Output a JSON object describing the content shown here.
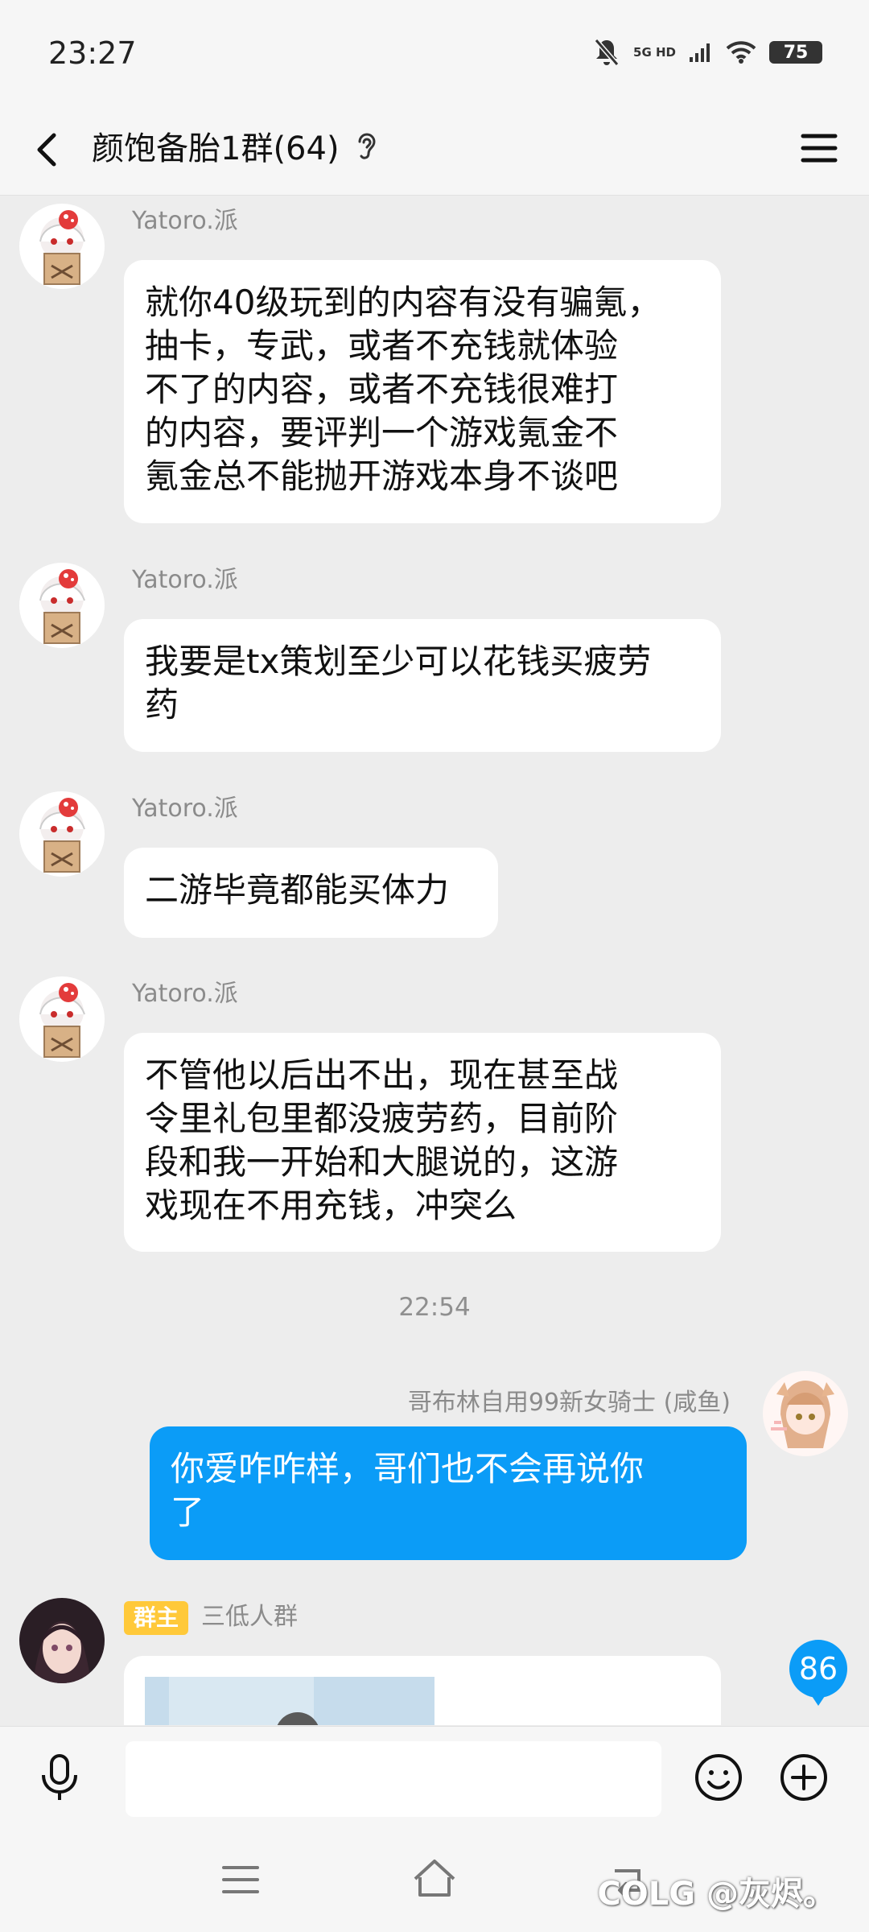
{
  "status": {
    "time": "23:27",
    "network": "5G HD",
    "battery": "75"
  },
  "header": {
    "title": "颜饱备胎1群(64)"
  },
  "messages": [
    {
      "sender": "Yatoro.派",
      "text": "就你40级玩到的内容有没有骗氪，\n抽卡，专武，或者不充钱就体验\n不了的内容，或者不充钱很难打\n的内容，要评判一个游戏氪金不\n氪金总不能抛开游戏本身不谈吧"
    },
    {
      "sender": "Yatoro.派",
      "text": "我要是tx策划至少可以花钱买疲劳\n药"
    },
    {
      "sender": "Yatoro.派",
      "text": "二游毕竟都能买体力"
    },
    {
      "sender": "Yatoro.派",
      "text": "不管他以后出不出，现在甚至战\n令里礼包里都没疲劳药，目前阶\n段和我一开始和大腿说的，这游\n戏现在不用充钱，冲突么"
    },
    {
      "timestamp": "22:54"
    },
    {
      "sender": "哥布林自用99新女骑士 (咸鱼)",
      "text": "你爱咋咋样，哥们也不会再说你\n了"
    },
    {
      "badge": "群主",
      "sender": "三低人群"
    }
  ],
  "unread_count": "86",
  "input": {
    "placeholder": ""
  },
  "watermark": "COLG @灰烬。",
  "colors": {
    "accent": "#0b9cf7",
    "badge": "#ffc93a"
  }
}
